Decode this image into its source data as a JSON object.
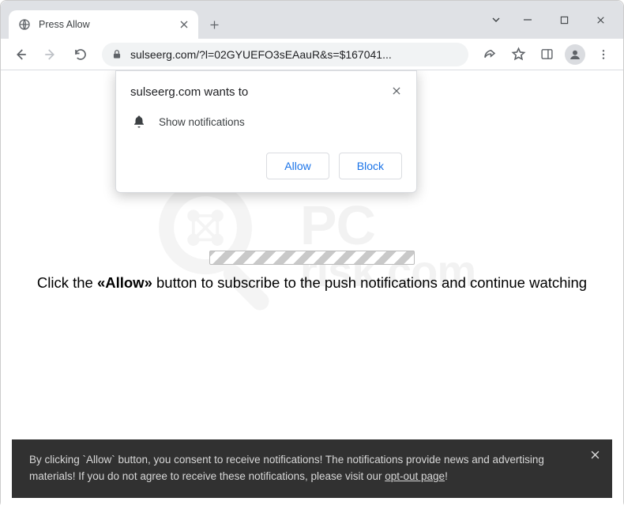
{
  "window": {
    "tab_title": "Press Allow"
  },
  "omnibox": {
    "url_display": "sulseerg.com/?l=02GYUEFO3sEAauR&s=$167041..."
  },
  "permission": {
    "origin_wants_to": "sulseerg.com wants to",
    "show_notifications": "Show notifications",
    "allow": "Allow",
    "block": "Block"
  },
  "page": {
    "instruction_prefix": "Click the ",
    "instruction_bold": "«Allow»",
    "instruction_suffix": " button to subscribe to the push notifications and continue watching"
  },
  "banner": {
    "text_1": "By clicking `Allow` button, you consent to receive notifications! The notifications provide news and advertising materials! If you do not agree to receive these notifications, please visit our ",
    "link": "opt-out page",
    "text_2": "!"
  },
  "watermark": {
    "line1": "PC",
    "line2": "risk.com"
  }
}
